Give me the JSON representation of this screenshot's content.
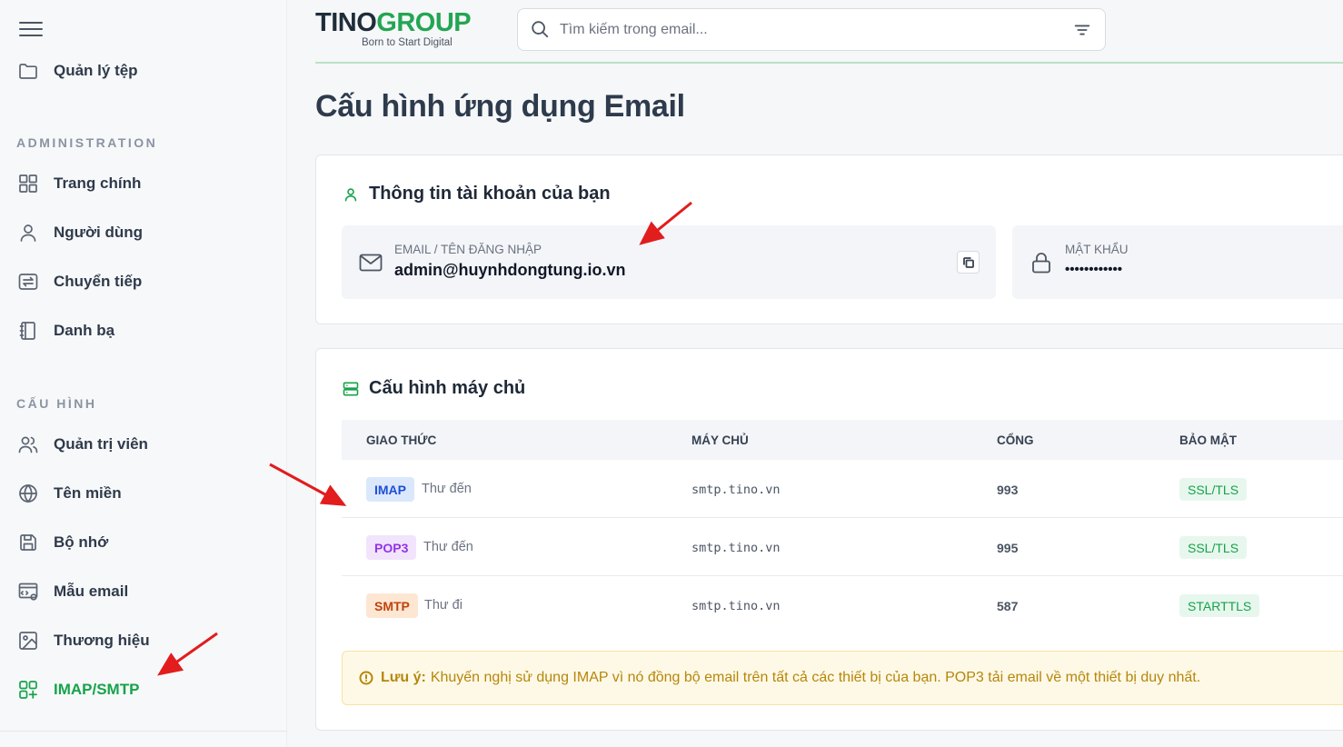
{
  "colors": {
    "accent": "#16a34a",
    "logo_dark": "#1f2d3a",
    "logo_green": "#22a652",
    "annotation": "#e11d1d",
    "imap_bg": "#dbe8fb",
    "imap_fg": "#1d4ed8",
    "pop3_bg": "#f1e4fc",
    "pop3_fg": "#9333ea",
    "smtp_bg": "#fde7d3",
    "smtp_fg": "#c2410c"
  },
  "header": {
    "logo_tino": "TINO",
    "logo_group": "GROUP",
    "logo_tagline": "Born to Start Digital",
    "search_placeholder": "Tìm kiếm trong email..."
  },
  "sidebar": {
    "top_item": {
      "label": "Quản lý tệp",
      "icon": "folder-icon"
    },
    "sections": [
      {
        "title": "ADMINISTRATION",
        "items": [
          {
            "label": "Trang chính",
            "icon": "dashboard-grid-icon"
          },
          {
            "label": "Người dùng",
            "icon": "user-icon"
          },
          {
            "label": "Chuyển tiếp",
            "icon": "forward-icon"
          },
          {
            "label": "Danh bạ",
            "icon": "contacts-book-icon"
          }
        ]
      },
      {
        "title": "CẤU HÌNH",
        "items": [
          {
            "label": "Quản trị viên",
            "icon": "users-icon"
          },
          {
            "label": "Tên miền",
            "icon": "globe-icon"
          },
          {
            "label": "Bộ nhớ",
            "icon": "save-disk-icon"
          },
          {
            "label": "Mẫu email",
            "icon": "template-icon"
          },
          {
            "label": "Thương hiệu",
            "icon": "image-icon"
          },
          {
            "label": "IMAP/SMTP",
            "icon": "apps-plus-icon",
            "active": true
          }
        ]
      }
    ]
  },
  "page": {
    "title": "Cấu hình ứng dụng Email"
  },
  "account": {
    "title": "Thông tin tài khoản của bạn",
    "email_label": "EMAIL / TÊN ĐĂNG NHẬP",
    "email_value": "admin@huynhdongtung.io.vn",
    "password_label": "MẬT KHẨU",
    "password_value": "••••••••••••"
  },
  "server": {
    "title": "Cấu hình máy chủ",
    "columns": [
      "GIAO THỨC",
      "MÁY CHỦ",
      "CỔNG",
      "BẢO MẬT"
    ],
    "rows": [
      {
        "protocol": "IMAP",
        "direction": "Thư đến",
        "host": "smtp.tino.vn",
        "port": "993",
        "security": "SSL/TLS"
      },
      {
        "protocol": "POP3",
        "direction": "Thư đến",
        "host": "smtp.tino.vn",
        "port": "995",
        "security": "SSL/TLS"
      },
      {
        "protocol": "SMTP",
        "direction": "Thư đi",
        "host": "smtp.tino.vn",
        "port": "587",
        "security": "STARTTLS"
      }
    ],
    "note_bold": "Lưu ý:",
    "note_text": "Khuyến nghị sử dụng IMAP vì nó đồng bộ email trên tất cả các thiết bị của bạn. POP3 tải email về một thiết bị duy nhất."
  }
}
